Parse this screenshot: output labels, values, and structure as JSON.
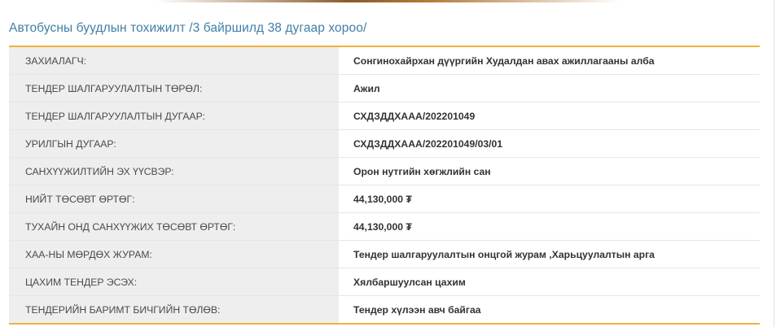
{
  "page": {
    "title": "Автобусны буудлын тохижилт /3 байршилд 38 дугаар хороо/"
  },
  "details": {
    "rows": [
      {
        "label": "ЗАХИАЛАГЧ:",
        "value": "Сонгинохайрхан дүүргийн Худалдан авах ажиллагааны алба"
      },
      {
        "label": "ТЕНДЕР ШАЛГАРУУЛАЛТЫН ТӨРӨЛ:",
        "value": "Ажил"
      },
      {
        "label": "ТЕНДЕР ШАЛГАРУУЛАЛТЫН ДУГААР:",
        "value": "СХДЗДДХААА/202201049"
      },
      {
        "label": "УРИЛГЫН ДУГААР:",
        "value": "СХДЗДДХААА/202201049/03/01"
      },
      {
        "label": "САНХҮҮЖИЛТИЙН ЭХ ҮҮСВЭР:",
        "value": "Орон нутгийн хөгжлийн сан"
      },
      {
        "label": "НИЙТ ТӨСӨВТ ӨРТӨГ:",
        "value": "44,130,000 ₮"
      },
      {
        "label": "ТУХАЙН ОНД САНХҮҮЖИХ ТӨСӨВТ ӨРТӨГ:",
        "value": "44,130,000 ₮"
      },
      {
        "label": "ХАА-НЫ МӨРДӨХ ЖУРАМ:",
        "value": "Тендер шалгаруулалтын онцгой журам ,Харьцуулалтын арга"
      },
      {
        "label": "ЦАХИМ ТЕНДЕР ЭСЭХ:",
        "value": "Хялбаршуулсан цахим"
      },
      {
        "label": "ТЕНДЕРИЙН БАРИМТ БИЧГИЙН ТӨЛӨВ:",
        "value": "Тендер хүлээн авч байгаа"
      }
    ]
  },
  "colors": {
    "title": "#3f7fa6",
    "accent_rule": "#f0b23a",
    "label_bg": "#eeeeee"
  }
}
